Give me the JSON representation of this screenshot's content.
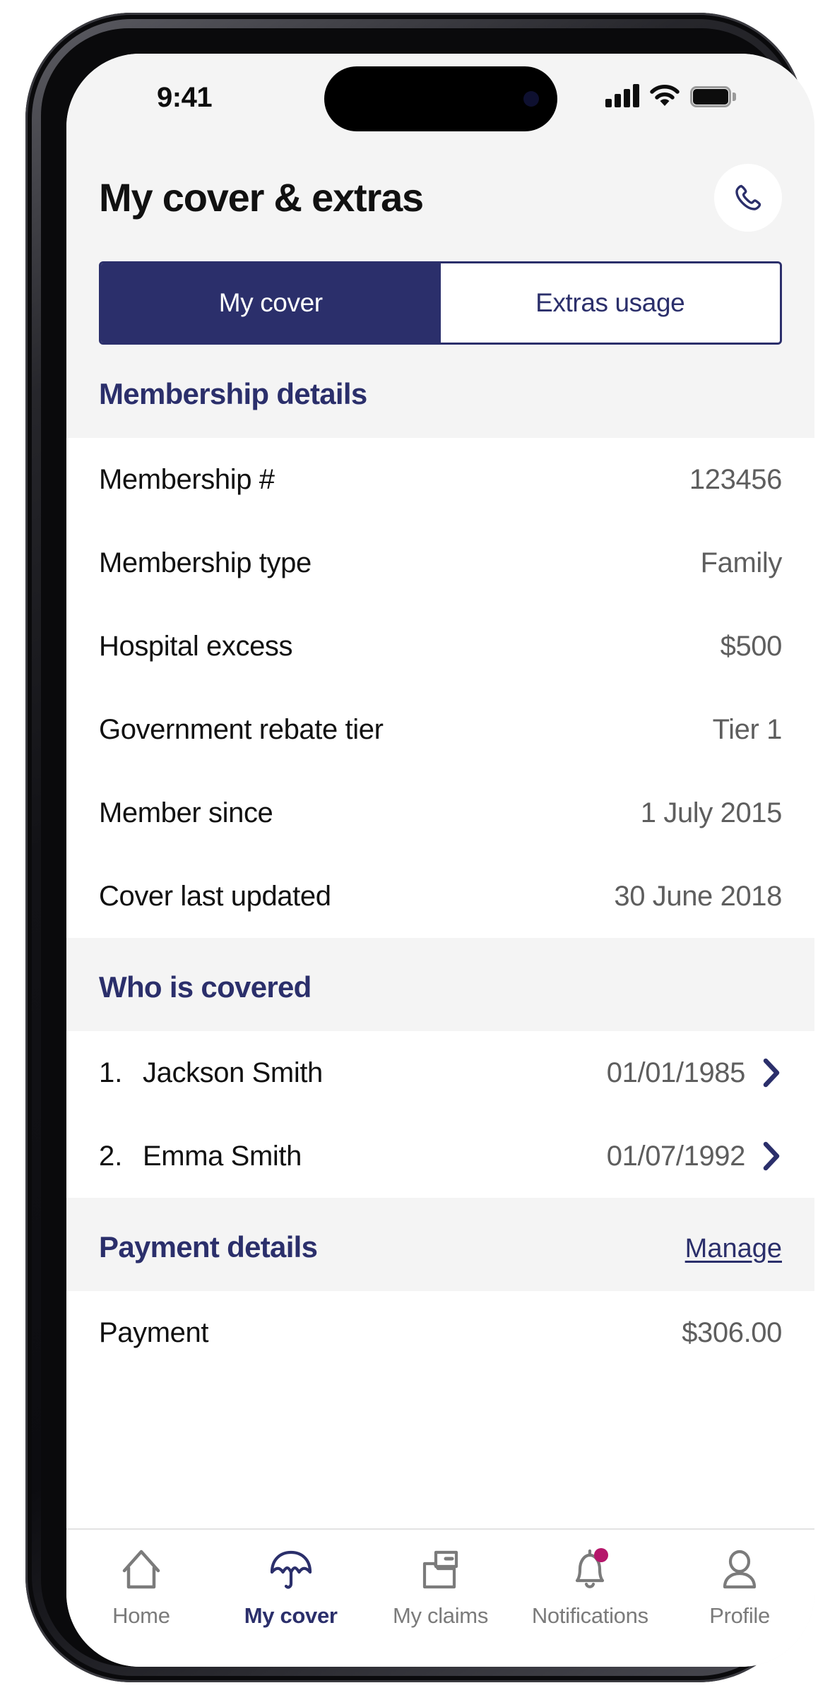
{
  "status_bar": {
    "time": "9:41",
    "cellular_icon": "cellular-bars-icon",
    "wifi_icon": "wifi-icon",
    "battery_icon": "battery-full-icon"
  },
  "header": {
    "title": "My cover & extras",
    "call_button_icon": "phone-icon"
  },
  "tabs": {
    "items": [
      {
        "label": "My cover",
        "active": true
      },
      {
        "label": "Extras usage",
        "active": false
      }
    ]
  },
  "membership": {
    "section_title": "Membership details",
    "rows": [
      {
        "label": "Membership #",
        "value": "123456"
      },
      {
        "label": "Membership type",
        "value": "Family"
      },
      {
        "label": "Hospital excess",
        "value": "$500"
      },
      {
        "label": "Government rebate tier",
        "value": "Tier 1"
      },
      {
        "label": "Member since",
        "value": "1 July 2015"
      },
      {
        "label": "Cover last updated",
        "value": "30 June 2018"
      }
    ]
  },
  "covered": {
    "section_title": "Who is covered",
    "people": [
      {
        "index": "1.",
        "name": "Jackson Smith",
        "dob": "01/01/1985"
      },
      {
        "index": "2.",
        "name": "Emma Smith",
        "dob": "01/07/1992"
      }
    ]
  },
  "payment": {
    "section_title": "Payment details",
    "action_label": "Manage",
    "rows": [
      {
        "label": "Payment",
        "value": "$306.00"
      }
    ]
  },
  "bottom_nav": {
    "items": [
      {
        "label": "Home",
        "icon": "home-icon",
        "active": false
      },
      {
        "label": "My cover",
        "icon": "umbrella-icon",
        "active": true
      },
      {
        "label": "My claims",
        "icon": "folder-icon",
        "active": false
      },
      {
        "label": "Notifications",
        "icon": "bell-icon",
        "active": false,
        "badge": true
      },
      {
        "label": "Profile",
        "icon": "person-icon",
        "active": false
      }
    ]
  },
  "colors": {
    "navy": "#2b2f6b",
    "magenta": "#b5176b",
    "gray_text": "#5e5e5e",
    "surface": "#f4f4f4"
  }
}
